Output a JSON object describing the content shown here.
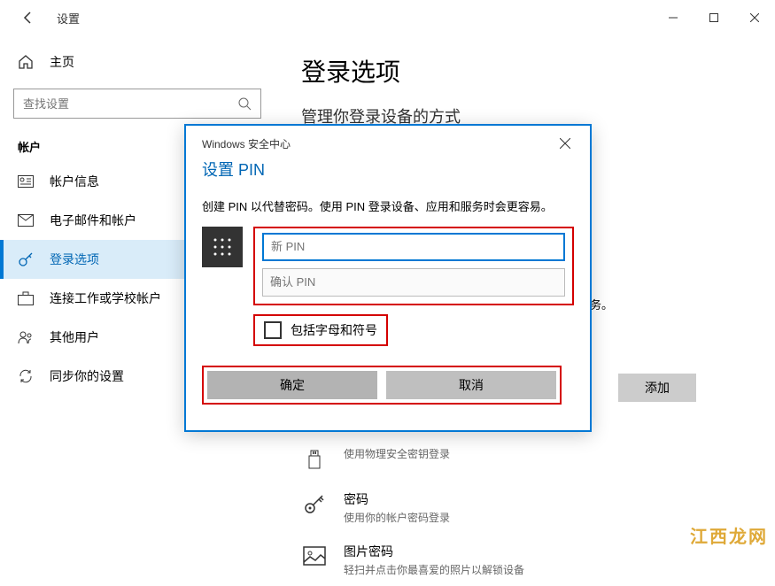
{
  "titlebar": {
    "title": "设置"
  },
  "sidebar": {
    "home": "主页",
    "search_placeholder": "查找设置",
    "category": "帐户",
    "items": [
      {
        "label": "帐户信息"
      },
      {
        "label": "电子邮件和帐户"
      },
      {
        "label": "登录选项"
      },
      {
        "label": "连接工作或学校帐户"
      },
      {
        "label": "其他用户"
      },
      {
        "label": "同步你的设置"
      }
    ]
  },
  "main": {
    "title": "登录选项",
    "subtitle": "管理你登录设备的方式",
    "service_suffix": "和服务。",
    "add_label": "添加",
    "options": [
      {
        "title": "",
        "desc": "使用物理安全密钥登录"
      },
      {
        "title": "密码",
        "desc": "使用你的帐户密码登录"
      },
      {
        "title": "图片密码",
        "desc": "轻扫并点击你最喜爱的照片以解锁设备"
      }
    ]
  },
  "dialog": {
    "header": "Windows 安全中心",
    "title": "设置 PIN",
    "desc": "创建 PIN 以代替密码。使用 PIN 登录设备、应用和服务时会更容易。",
    "new_pin_placeholder": "新 PIN",
    "confirm_pin_placeholder": "确认 PIN",
    "checkbox_label": "包括字母和符号",
    "ok_label": "确定",
    "cancel_label": "取消"
  },
  "watermark": "江西龙网"
}
